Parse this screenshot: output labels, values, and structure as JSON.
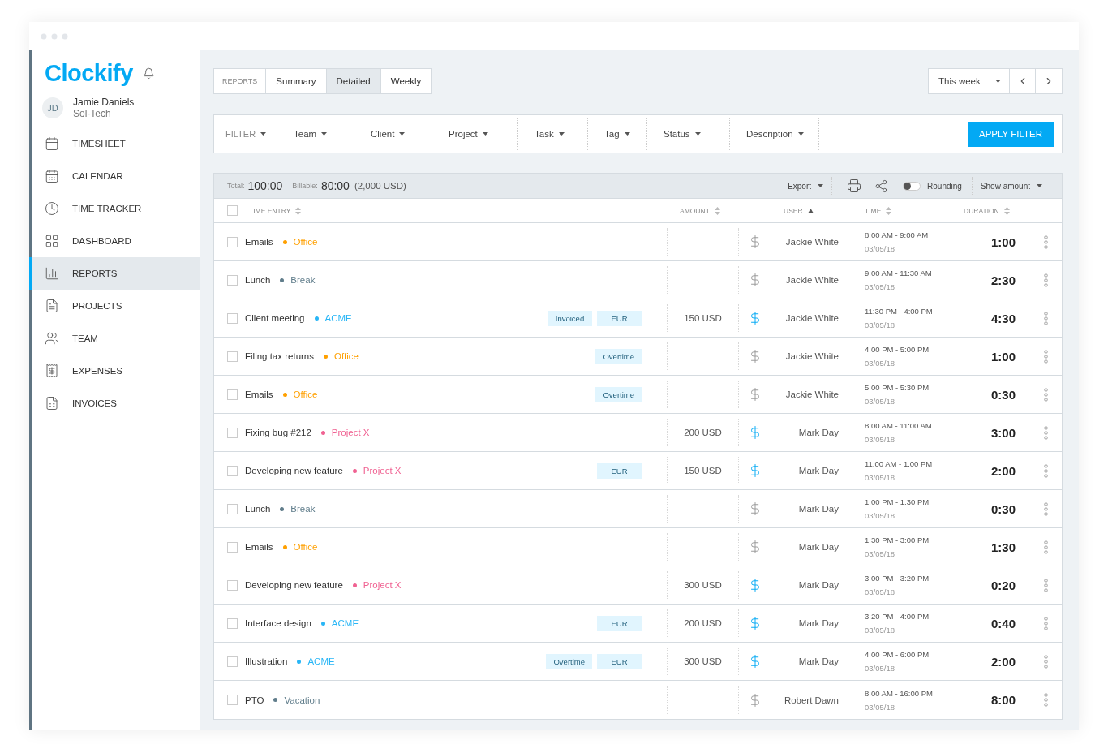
{
  "sidebar": {
    "logo": "Clockify",
    "user": {
      "initials": "JD",
      "name": "Jamie Daniels",
      "company": "Sol-Tech"
    },
    "items": [
      {
        "label": "TIMESHEET",
        "selected": false
      },
      {
        "label": "CALENDAR",
        "selected": false
      },
      {
        "label": "TIME TRACKER",
        "selected": false
      },
      {
        "label": "DASHBOARD",
        "selected": false
      },
      {
        "label": "REPORTS",
        "selected": true
      },
      {
        "label": "PROJECTS",
        "selected": false
      },
      {
        "label": "TEAM",
        "selected": false
      },
      {
        "label": "EXPENSES",
        "selected": false
      },
      {
        "label": "INVOICES",
        "selected": false
      }
    ]
  },
  "report_tabs": {
    "label": "REPORTS",
    "tabs": [
      {
        "label": "Summary",
        "selected": false
      },
      {
        "label": "Detailed",
        "selected": true
      },
      {
        "label": "Weekly",
        "selected": false
      }
    ]
  },
  "date_range": {
    "value": "This week"
  },
  "filters": {
    "label": "FILTER",
    "items": [
      "Team",
      "Client",
      "Project",
      "Task",
      "Tag",
      "Status",
      "Description"
    ],
    "apply": "APPLY FILTER"
  },
  "summary": {
    "total_label": "Total:",
    "total": "100:00",
    "billable_label": "Billable:",
    "billable": "80:00",
    "amount": "(2,000 USD)",
    "export": "Export",
    "rounding": {
      "label": "Rounding",
      "on": false
    },
    "show_amount": "Show amount"
  },
  "table": {
    "select_all_checked": false,
    "columns": [
      {
        "label": "TIME ENTRY",
        "sorted": false
      },
      {
        "label": "AMOUNT",
        "sorted": false
      },
      {
        "label": "USER",
        "sorted": true
      },
      {
        "label": "TIME",
        "sorted": false
      },
      {
        "label": "DURATION",
        "sorted": false
      }
    ],
    "rows": [
      {
        "checked": false,
        "description": "Emails",
        "project": "Office",
        "color": "#ffa000",
        "tags": [],
        "amount": "",
        "billable": false,
        "user": "Jackie White",
        "time": "8:00 AM - 9:00 AM",
        "date": "03/05/18",
        "duration": "1:00"
      },
      {
        "checked": false,
        "description": "Lunch",
        "project": "Break",
        "color": "#607d8b",
        "tags": [],
        "amount": "",
        "billable": false,
        "user": "Jackie White",
        "time": "9:00 AM - 11:30 AM",
        "date": "03/05/18",
        "duration": "2:30"
      },
      {
        "checked": false,
        "description": "Client meeting",
        "project": "ACME",
        "color": "#29b6f6",
        "tags": [
          "Invoiced",
          "EUR"
        ],
        "amount": "150 USD",
        "billable": true,
        "user": "Jackie White",
        "time": "11:30 PM - 4:00 PM",
        "date": "03/05/18",
        "duration": "4:30"
      },
      {
        "checked": false,
        "description": "Filing tax returns",
        "project": "Office",
        "color": "#ffa000",
        "tags": [
          "Overtime"
        ],
        "amount": "",
        "billable": false,
        "user": "Jackie White",
        "time": "4:00 PM - 5:00 PM",
        "date": "03/05/18",
        "duration": "1:00"
      },
      {
        "checked": false,
        "description": "Emails",
        "project": "Office",
        "color": "#ffa000",
        "tags": [
          "Overtime"
        ],
        "amount": "",
        "billable": false,
        "user": "Jackie White",
        "time": "5:00 PM - 5:30 PM",
        "date": "03/05/18",
        "duration": "0:30"
      },
      {
        "checked": false,
        "description": "Fixing bug #212",
        "project": "Project X",
        "color": "#f06292",
        "tags": [],
        "amount": "200 USD",
        "billable": true,
        "user": "Mark Day",
        "time": "8:00 AM - 11:00 AM",
        "date": "03/05/18",
        "duration": "3:00"
      },
      {
        "checked": false,
        "description": "Developing new feature",
        "project": "Project X",
        "color": "#f06292",
        "tags": [
          "EUR"
        ],
        "amount": "150 USD",
        "billable": true,
        "user": "Mark Day",
        "time": "11:00 AM - 1:00 PM",
        "date": "03/05/18",
        "duration": "2:00"
      },
      {
        "checked": false,
        "description": "Lunch",
        "project": "Break",
        "color": "#607d8b",
        "tags": [],
        "amount": "",
        "billable": false,
        "user": "Mark Day",
        "time": "1:00 PM - 1:30 PM",
        "date": "03/05/18",
        "duration": "0:30"
      },
      {
        "checked": false,
        "description": "Emails",
        "project": "Office",
        "color": "#ffa000",
        "tags": [],
        "amount": "",
        "billable": false,
        "user": "Mark Day",
        "time": "1:30 PM - 3:00 PM",
        "date": "03/05/18",
        "duration": "1:30"
      },
      {
        "checked": false,
        "description": "Developing new feature",
        "project": "Project X",
        "color": "#f06292",
        "tags": [],
        "amount": "300 USD",
        "billable": true,
        "user": "Mark Day",
        "time": "3:00 PM - 3:20 PM",
        "date": "03/05/18",
        "duration": "0:20"
      },
      {
        "checked": false,
        "description": "Interface design",
        "project": "ACME",
        "color": "#29b6f6",
        "tags": [
          "EUR"
        ],
        "amount": "200 USD",
        "billable": true,
        "user": "Mark Day",
        "time": "3:20 PM - 4:00 PM",
        "date": "03/05/18",
        "duration": "0:40"
      },
      {
        "checked": false,
        "description": "Illustration",
        "project": "ACME",
        "color": "#29b6f6",
        "tags": [
          "Overtime",
          "EUR"
        ],
        "amount": "300 USD",
        "billable": true,
        "user": "Mark Day",
        "time": "4:00 PM - 6:00 PM",
        "date": "03/05/18",
        "duration": "2:00"
      },
      {
        "checked": false,
        "description": "PTO",
        "project": "Vacation",
        "color": "#607d8b",
        "tags": [],
        "amount": "",
        "billable": false,
        "user": "Robert Dawn",
        "time": "8:00 AM - 16:00 PM",
        "date": "03/05/18",
        "duration": "8:00"
      }
    ]
  }
}
